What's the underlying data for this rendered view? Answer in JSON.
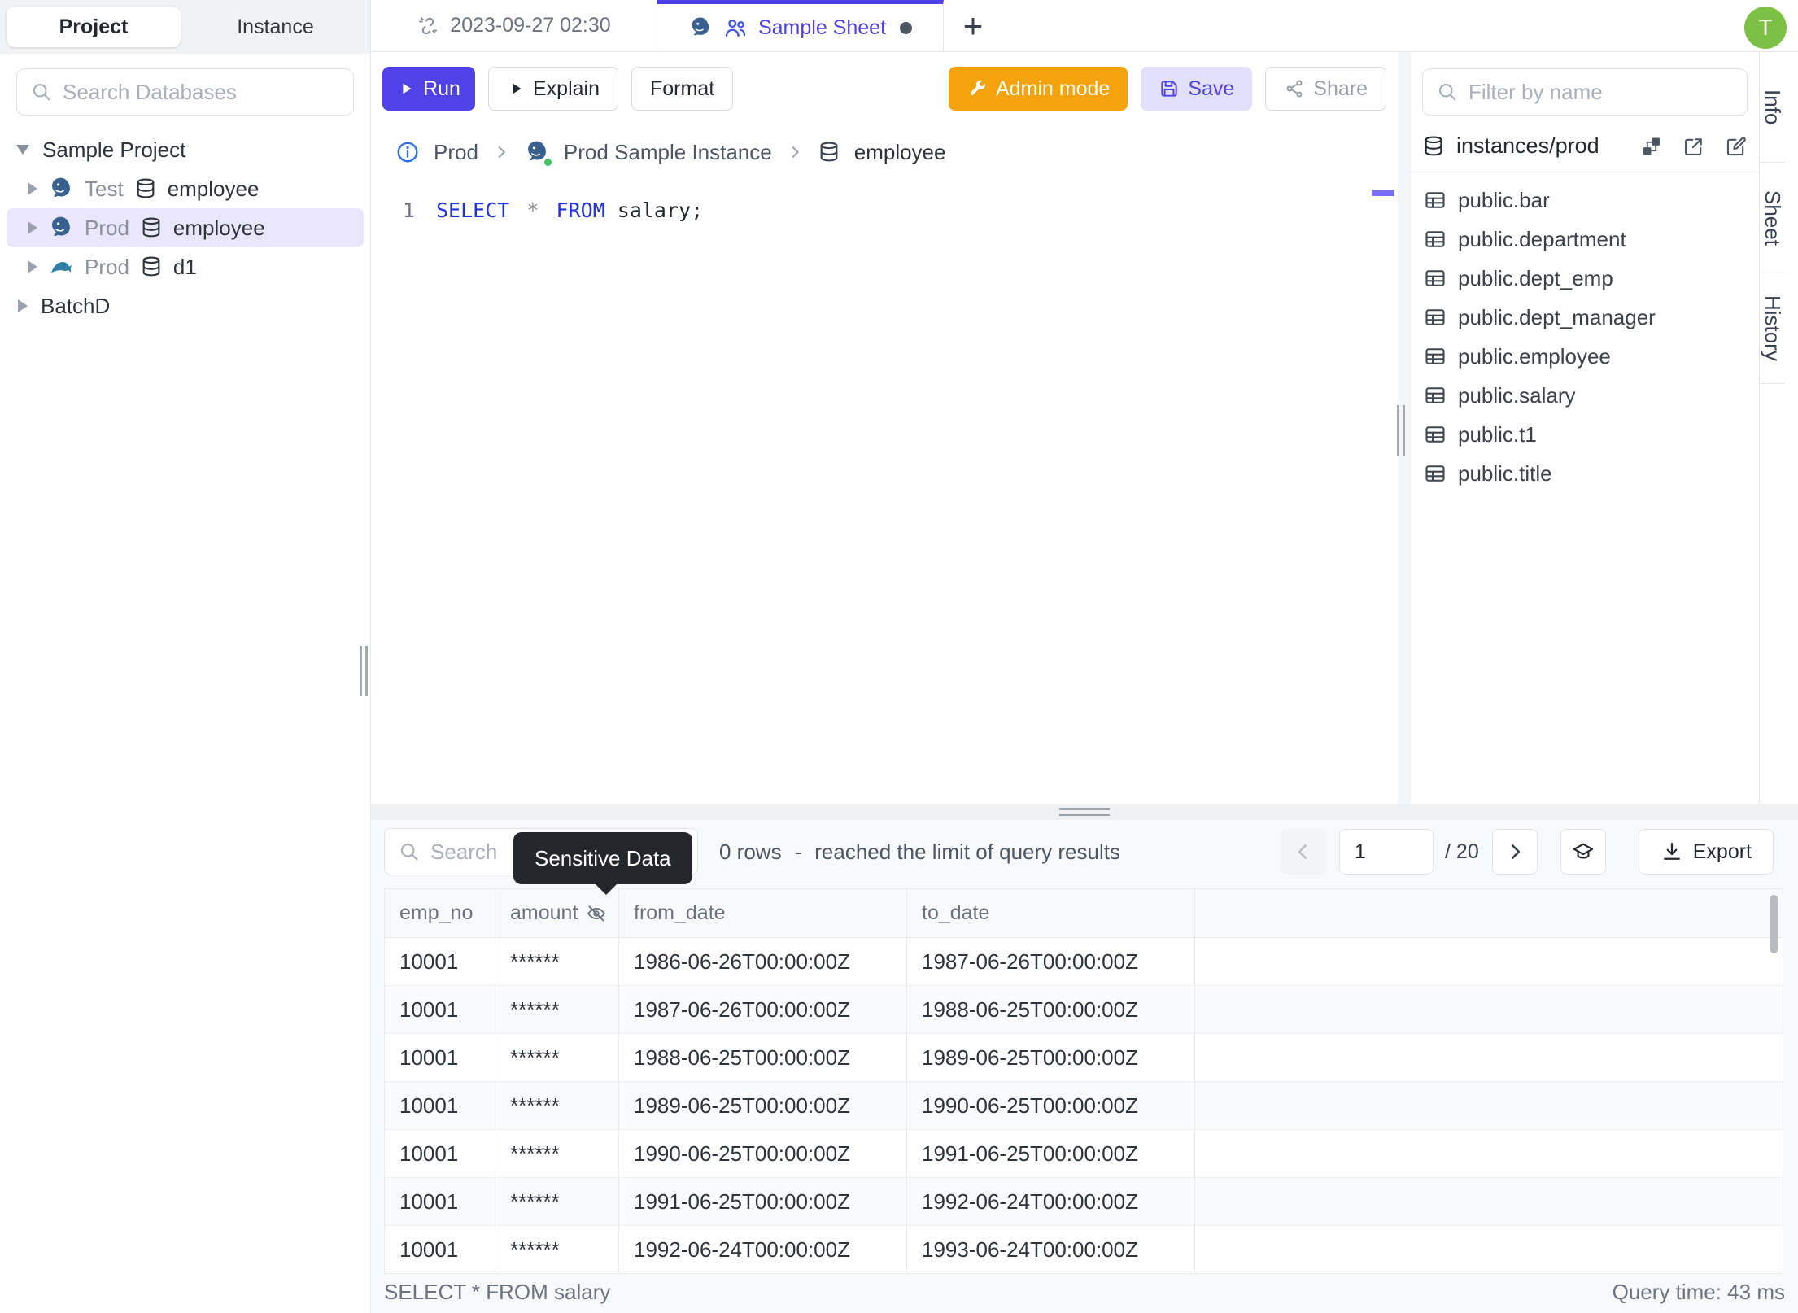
{
  "colors": {
    "accent_indigo": "#4f42e8",
    "admin_orange": "#f5a30b",
    "avatar_green": "#7bc143",
    "keyword_blue": "#2230dd",
    "tooltip_bg": "#24262b",
    "selected_tree_bg": "#eae7fc",
    "postgres_blue": "#39618f",
    "mysql_teal": "#2e7fa5"
  },
  "left_sidebar": {
    "tabs": {
      "project": "Project",
      "instance": "Instance"
    },
    "search_placeholder": "Search Databases",
    "tree": {
      "project_label": "Sample Project",
      "items": [
        {
          "engine": "postgres",
          "env": "Test",
          "db": "employee",
          "selected": false
        },
        {
          "engine": "postgres",
          "env": "Prod",
          "db": "employee",
          "selected": true
        },
        {
          "engine": "mysql",
          "env": "Prod",
          "db": "d1",
          "selected": false
        }
      ],
      "collapsed_project": "BatchD"
    }
  },
  "tabbar": {
    "tab1": "2023-09-27 02:30",
    "tab2": "Sample Sheet",
    "new_tab": "+",
    "avatar_initial": "T"
  },
  "toolbar": {
    "run": "Run",
    "explain": "Explain",
    "format": "Format",
    "admin_mode": "Admin mode",
    "save": "Save",
    "share": "Share"
  },
  "breadcrumb": {
    "env": "Prod",
    "instance": "Prod Sample Instance",
    "database": "employee"
  },
  "editor": {
    "line_number": "1",
    "sql": {
      "keyword1": "SELECT",
      "star": "*",
      "keyword2": "FROM",
      "rest": "salary;"
    }
  },
  "right_sidebar": {
    "filter_placeholder": "Filter by name",
    "path": "instances/prod",
    "tables": [
      "public.bar",
      "public.department",
      "public.dept_emp",
      "public.dept_manager",
      "public.employee",
      "public.salary",
      "public.t1",
      "public.title"
    ],
    "panel_tabs": [
      "Info",
      "Sheet",
      "History"
    ]
  },
  "results": {
    "search_placeholder": "Search",
    "tooltip": "Sensitive Data",
    "row_count": "0 rows",
    "dash": "-",
    "limit_text": "reached the limit of query results",
    "page": "1",
    "page_total": "/ 20",
    "export_label": "Export",
    "table": {
      "columns": [
        "emp_no",
        "amount",
        "from_date",
        "to_date"
      ],
      "masked_column": "amount",
      "rows": [
        [
          "10001",
          "******",
          "1986-06-26T00:00:00Z",
          "1987-06-26T00:00:00Z"
        ],
        [
          "10001",
          "******",
          "1987-06-26T00:00:00Z",
          "1988-06-25T00:00:00Z"
        ],
        [
          "10001",
          "******",
          "1988-06-25T00:00:00Z",
          "1989-06-25T00:00:00Z"
        ],
        [
          "10001",
          "******",
          "1989-06-25T00:00:00Z",
          "1990-06-25T00:00:00Z"
        ],
        [
          "10001",
          "******",
          "1990-06-25T00:00:00Z",
          "1991-06-25T00:00:00Z"
        ],
        [
          "10001",
          "******",
          "1991-06-25T00:00:00Z",
          "1992-06-24T00:00:00Z"
        ],
        [
          "10001",
          "******",
          "1992-06-24T00:00:00Z",
          "1993-06-24T00:00:00Z"
        ]
      ]
    },
    "status_left": "SELECT * FROM salary",
    "status_right": "Query time: 43 ms"
  }
}
